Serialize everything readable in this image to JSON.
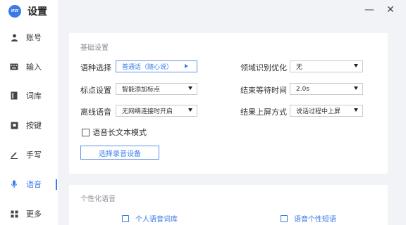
{
  "app": {
    "logo_text": "iFLY",
    "title": "设置",
    "accent_color": "#3a7be8"
  },
  "window": {
    "minimize_symbol": "—",
    "close_symbol": "✕"
  },
  "sidebar": {
    "items": [
      {
        "label": "账号",
        "icon": "person-icon"
      },
      {
        "label": "输入",
        "icon": "keyboard-icon"
      },
      {
        "label": "词库",
        "icon": "book-icon"
      },
      {
        "label": "按键",
        "icon": "key-icon"
      },
      {
        "label": "手写",
        "icon": "pen-icon"
      },
      {
        "label": "语音",
        "icon": "mic-icon",
        "active": true
      },
      {
        "label": "更多",
        "icon": "grid-icon"
      }
    ]
  },
  "basic": {
    "section_title": "基础设置",
    "language_label": "语种选择",
    "language_value": "普通话（随心说）",
    "punctuation_label": "标点设置",
    "punctuation_value": "智能添加标点",
    "offline_label": "离线语音",
    "offline_value": "无网络连接时开启",
    "domain_label": "领域识别优化",
    "domain_value": "无",
    "wait_label": "结束等待时间",
    "wait_value": "2.0s",
    "screen_label": "结果上屏方式",
    "screen_value": "说话过程中上屏",
    "longtext_label": "语音长文本模式",
    "longtext_checked": false,
    "device_button": "选择录音设备"
  },
  "personal": {
    "section_title": "个性化语音",
    "lexicon_link": "个人语音词库",
    "phrase_link": "语音个性短语"
  }
}
